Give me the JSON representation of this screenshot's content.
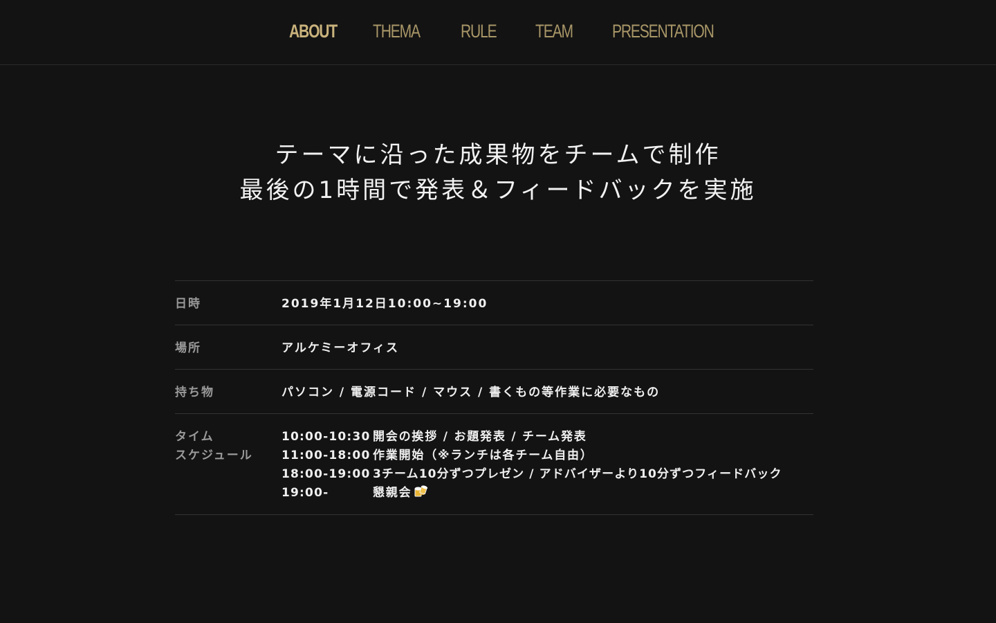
{
  "colors": {
    "background": "#131313",
    "nav_active": "#c9b27c",
    "nav_inactive": "#a99768",
    "label": "#9a9a9a",
    "text": "#f0f0f0",
    "divider": "#333333"
  },
  "nav": {
    "items": [
      {
        "label": "ABOUT",
        "active": true
      },
      {
        "label": "THEMA",
        "active": false
      },
      {
        "label": "RULE",
        "active": false
      },
      {
        "label": "TEAM",
        "active": false
      },
      {
        "label": "PRESENTATION",
        "active": false
      }
    ]
  },
  "hero": {
    "line1": "テーマに沿った成果物をチームで制作",
    "line2": "最後の1時間で発表＆フィードバックを実施"
  },
  "info": {
    "date": {
      "label": "日時",
      "value": "2019年1月12日10:00~19:00"
    },
    "place": {
      "label": "場所",
      "value": "アルケミーオフィス"
    },
    "belongings": {
      "label": "持ち物",
      "value": "パソコン / 電源コード / マウス / 書くもの等作業に必要なもの"
    },
    "schedule": {
      "label_line1": "タイム",
      "label_line2": "スケジュール",
      "items": [
        {
          "time": "10:00-10:30",
          "desc": "開会の挨拶 / お題発表 / チーム発表"
        },
        {
          "time": "11:00-18:00",
          "desc": "作業開始（※ランチは各チーム自由）"
        },
        {
          "time": "18:00-19:00",
          "desc": "3チーム10分ずつプレゼン / アドバイザーより10分ずつフィードバック"
        },
        {
          "time": "19:00-",
          "desc": "懇親会",
          "icon": "beer-mugs-icon"
        }
      ]
    }
  }
}
